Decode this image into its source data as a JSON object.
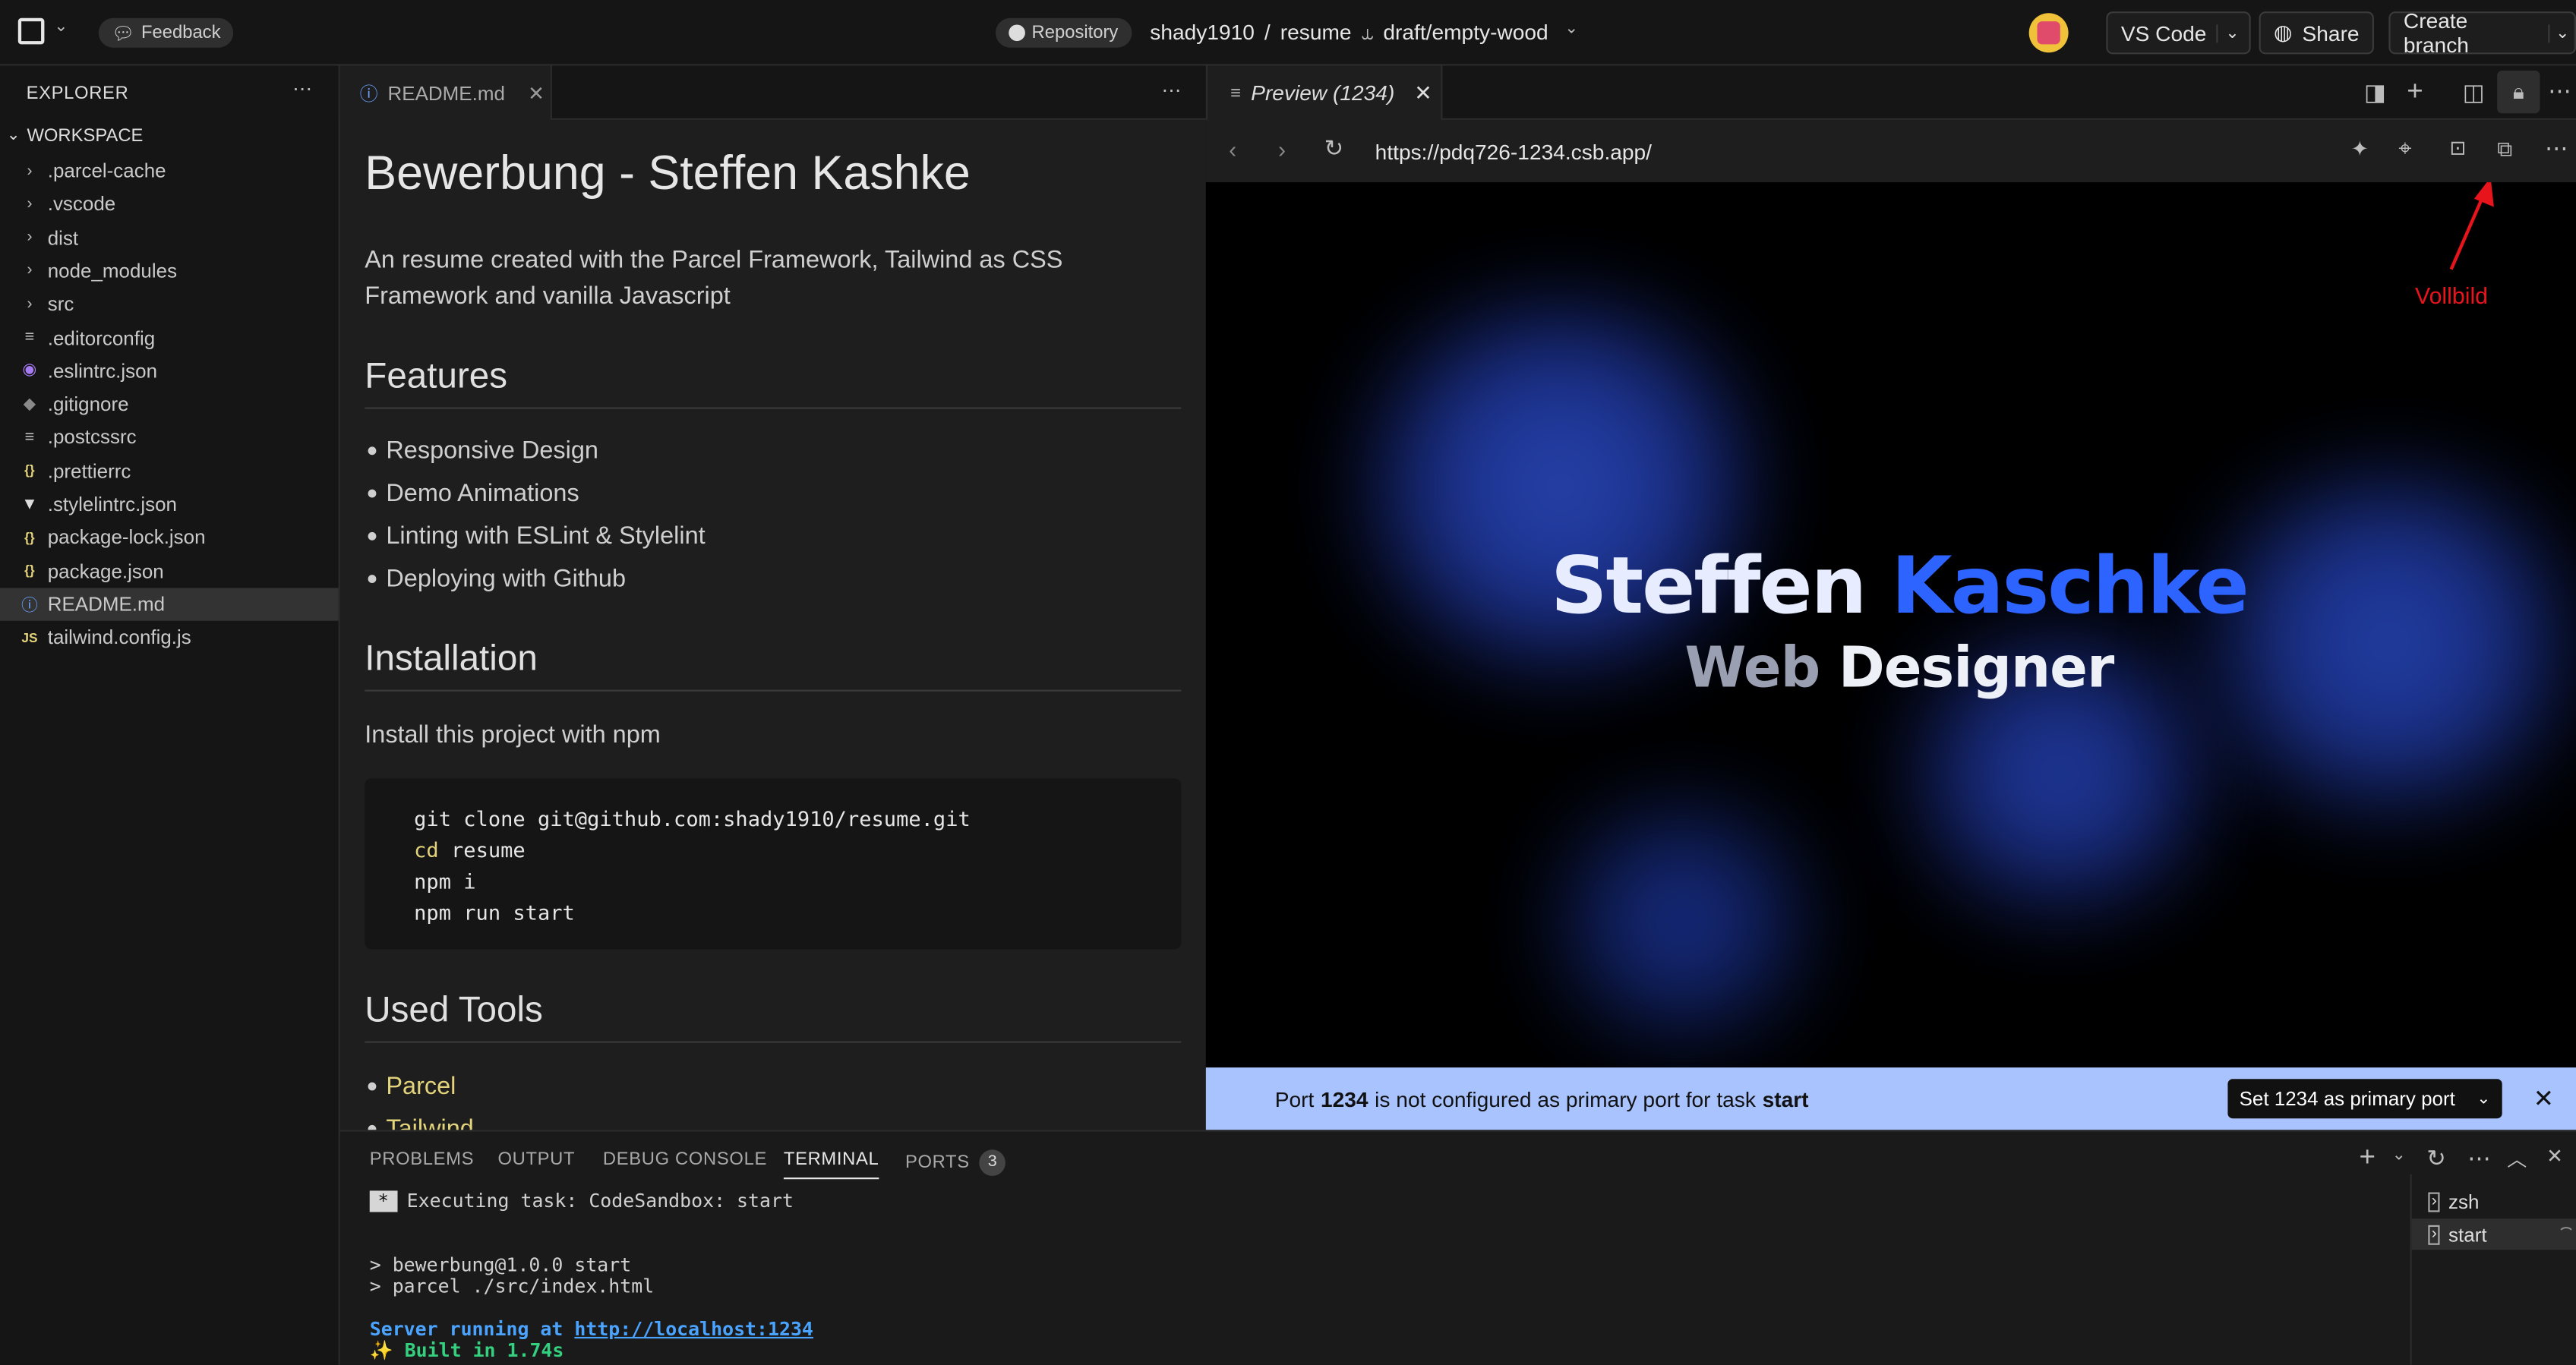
{
  "topbar": {
    "feedback_label": "Feedback",
    "repository_label": "Repository",
    "owner": "shady1910",
    "separator": "/",
    "repo": "resume",
    "branch": "draft/empty-wood",
    "vscode_label": "VS Code",
    "share_label": "Share",
    "create_branch_label": "Create branch"
  },
  "explorer": {
    "title": "EXPLORER",
    "workspace": "WORKSPACE",
    "items": [
      {
        "label": ".parcel-cache",
        "kind": "folder"
      },
      {
        "label": ".vscode",
        "kind": "folder"
      },
      {
        "label": "dist",
        "kind": "folder"
      },
      {
        "label": "node_modules",
        "kind": "folder"
      },
      {
        "label": "src",
        "kind": "folder"
      },
      {
        "label": ".editorconfig",
        "kind": "file"
      },
      {
        "label": ".eslintrc.json",
        "kind": "eslint"
      },
      {
        "label": ".gitignore",
        "kind": "git"
      },
      {
        "label": ".postcssrc",
        "kind": "file"
      },
      {
        "label": ".prettierrc",
        "kind": "json"
      },
      {
        "label": ".stylelintrc.json",
        "kind": "stylelint"
      },
      {
        "label": "package-lock.json",
        "kind": "json"
      },
      {
        "label": "package.json",
        "kind": "json"
      },
      {
        "label": "README.md",
        "kind": "info",
        "selected": true
      },
      {
        "label": "tailwind.config.js",
        "kind": "js"
      }
    ]
  },
  "editor": {
    "tab_label": "README.md",
    "h1": "Bewerbung - Steffen Kashke",
    "intro": "An resume created with the Parcel Framework, Tailwind as CSS Framework and vanilla Javascript",
    "features_heading": "Features",
    "features": [
      "Responsive Design",
      "Demo Animations",
      "Linting with ESLint & Stylelint",
      "Deploying with Github"
    ],
    "installation_heading": "Installation",
    "install_text": "Install this project with npm",
    "code_lines": [
      "git clone git@github.com:shady1910/resume.git",
      "cd resume",
      "npm i",
      "npm run start"
    ],
    "tools_heading": "Used Tools",
    "tools": [
      "Parcel",
      "Tailwind"
    ]
  },
  "preview": {
    "tab_label": "Preview (1234)",
    "url": "https://pdq726-1234.csb.app/",
    "name_first": "Steffen",
    "name_last": "Kaschke",
    "subtitle_a": "Web",
    "subtitle_b": "Designer",
    "annotation": "Vollbild",
    "annotation_color": "#e8141c"
  },
  "port_notice": {
    "text_a": "Port",
    "port": "1234",
    "text_b": "is not configured as primary port for task",
    "task": "start",
    "button_label": "Set 1234 as primary port"
  },
  "panel": {
    "tabs": [
      "PROBLEMS",
      "OUTPUT",
      "DEBUG CONSOLE",
      "TERMINAL",
      "PORTS"
    ],
    "active_tab": "TERMINAL",
    "ports_count": "3",
    "terminal_lines": {
      "task": "Executing task: CodeSandbox: start",
      "l1": "> bewerbung@1.0.0 start",
      "l2": "> parcel ./src/index.html",
      "server_prefix": "Server running at",
      "server_url": "http://localhost:1234",
      "built": "✨ Built in 1.74s"
    },
    "terminals": [
      "zsh",
      "start"
    ]
  }
}
